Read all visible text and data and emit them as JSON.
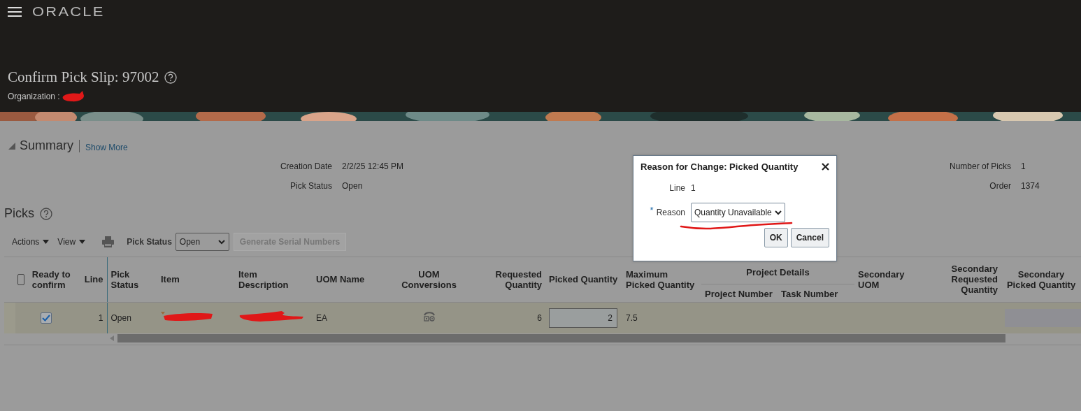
{
  "header": {
    "logo": "ORACLE"
  },
  "page": {
    "title": "Confirm Pick Slip: 97002",
    "organization_label": "Organization :"
  },
  "summary": {
    "title": "Summary",
    "show_more": "Show More",
    "left_fields": [
      {
        "label": "Creation Date",
        "value": "2/2/25 12:45 PM"
      },
      {
        "label": "Pick Status",
        "value": "Open"
      }
    ],
    "right_fields": [
      {
        "label": "Number of Picks",
        "value": "1"
      },
      {
        "label": "Order",
        "value": "1374"
      }
    ]
  },
  "picks": {
    "title": "Picks",
    "toolbar": {
      "actions": "Actions",
      "view": "View",
      "pick_status_label": "Pick Status",
      "pick_status_value": "Open",
      "generate_button": {
        "label": "Generate Serial Numbers",
        "disabled": true
      }
    },
    "select_all_checked": false,
    "columns": [
      {
        "kind": "column",
        "label": "Ready to confirm"
      },
      {
        "kind": "column",
        "label": "Line"
      },
      {
        "kind": "column",
        "label": "Pick Status"
      },
      {
        "kind": "column",
        "label": "Item"
      },
      {
        "kind": "column",
        "label": "Item Description"
      },
      {
        "kind": "column",
        "label": "UOM Name"
      },
      {
        "kind": "column",
        "label": "UOM Conversions"
      },
      {
        "kind": "column",
        "label": "Requested Quantity"
      },
      {
        "kind": "column",
        "label": "Picked Quantity"
      },
      {
        "kind": "column",
        "label": "Maximum Picked Quantity"
      },
      {
        "kind": "group",
        "label": "Project Details",
        "columns": [
          {
            "label": "Project Number"
          },
          {
            "label": "Task Number"
          }
        ]
      },
      {
        "kind": "column",
        "label": "Secondary UOM"
      },
      {
        "kind": "column",
        "label": "Secondary Requested Quantity"
      },
      {
        "kind": "column",
        "label": "Secondary Picked Quantity"
      }
    ],
    "rows": [
      {
        "selected": true,
        "ready": true,
        "line": "1",
        "pick_status": "Open",
        "uom_name": "EA",
        "requested": "6",
        "picked": "2",
        "maximum": "7.5"
      }
    ]
  },
  "dialog": {
    "title": "Reason for Change: Picked Quantity",
    "line_label": "Line",
    "line_value": "1",
    "reason_label": "Reason",
    "required_mark": "*",
    "reason_value": "Quantity Unavailable",
    "ok": "OK",
    "cancel": "Cancel"
  }
}
